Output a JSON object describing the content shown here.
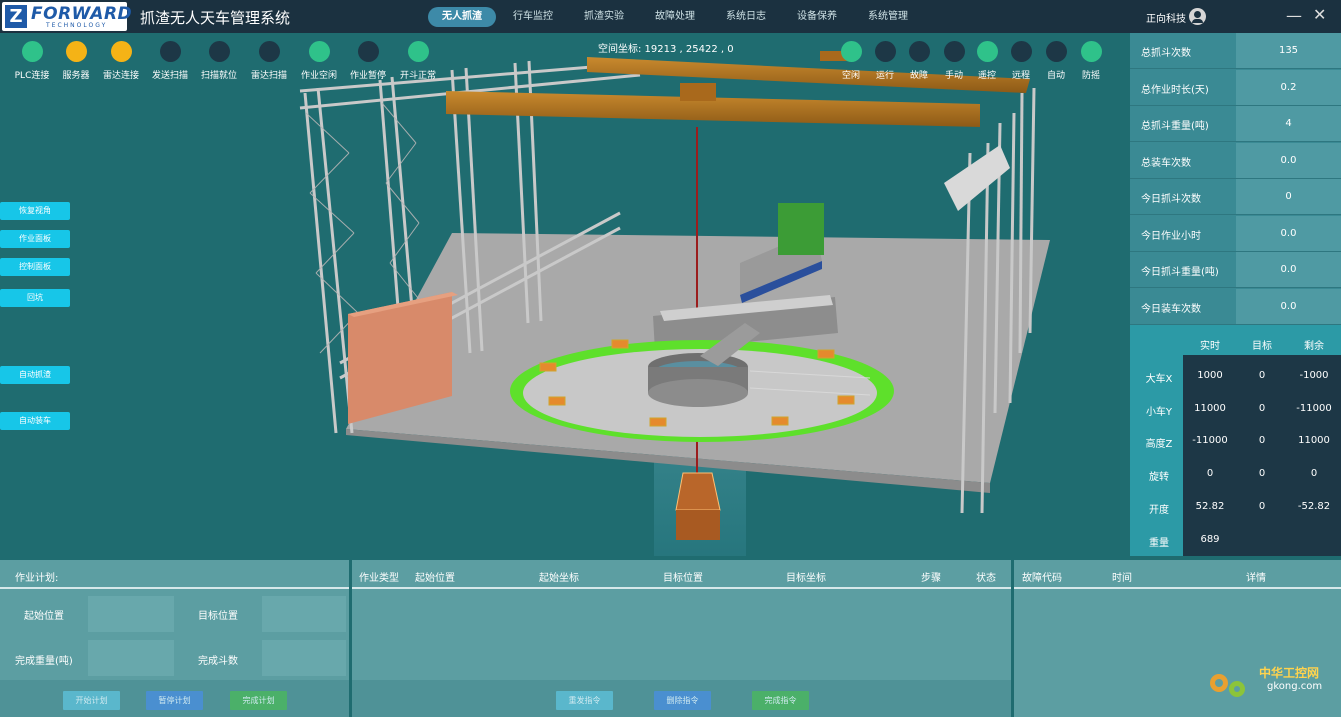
{
  "header": {
    "logo_brand": "FORWARD",
    "logo_sub": "TECHNOLOGY",
    "app_title": "抓渣无人天车管理系统",
    "tabs": [
      "无人抓渣",
      "行车监控",
      "抓渣实验",
      "故障处理",
      "系统日志",
      "设备保养",
      "系统管理"
    ],
    "active_tab": "无人抓渣",
    "company": "正向科技",
    "minimize": "—",
    "close": "✕"
  },
  "status_lights": [
    {
      "label": "PLC连接",
      "color": "#2fc28a"
    },
    {
      "label": "服务器",
      "color": "#f5b316"
    },
    {
      "label": "雷达连接",
      "color": "#f5b316"
    },
    {
      "label": "发送扫描",
      "color": "#1d3746"
    },
    {
      "label": "扫描就位",
      "color": "#1d3746"
    },
    {
      "label": "雷达扫描",
      "color": "#1d3746"
    },
    {
      "label": "作业空闲",
      "color": "#2fc28a"
    },
    {
      "label": "作业暂停",
      "color": "#1d3746"
    },
    {
      "label": "开斗正常",
      "color": "#2fc28a"
    }
  ],
  "mode_lights": [
    {
      "label": "空闲",
      "color": "#2fc28a"
    },
    {
      "label": "运行",
      "color": "#1d3746"
    },
    {
      "label": "故障",
      "color": "#1d3746"
    },
    {
      "label": "手动",
      "color": "#1d3746"
    },
    {
      "label": "遥控",
      "color": "#2fc28a"
    },
    {
      "label": "远程",
      "color": "#1d3746"
    },
    {
      "label": "自动",
      "color": "#1d3746"
    },
    {
      "label": "防摇",
      "color": "#2fc28a"
    }
  ],
  "space_coord": "空间坐标:  19213 , 25422 , 0",
  "side_buttons": [
    "恢复视角",
    "作业面板",
    "控制面板",
    "回坑",
    "自动抓渣",
    "自动装车"
  ],
  "stats": [
    {
      "label": "总抓斗次数",
      "value": "135"
    },
    {
      "label": "总作业时长(天)",
      "value": "0.2"
    },
    {
      "label": "总抓斗重量(吨)",
      "value": "4"
    },
    {
      "label": "总装车次数",
      "value": "0.0"
    },
    {
      "label": "今日抓斗次数",
      "value": "0"
    },
    {
      "label": "今日作业小时",
      "value": "0.0"
    },
    {
      "label": "今日抓斗重量(吨)",
      "value": "0.0"
    },
    {
      "label": "今日装车次数",
      "value": "0.0"
    }
  ],
  "axes": {
    "headers": [
      "实时",
      "目标",
      "剩余"
    ],
    "rows": [
      {
        "label": "大车X",
        "realtime": "1000",
        "target": "0",
        "remain": "-1000"
      },
      {
        "label": "小车Y",
        "realtime": "11000",
        "target": "0",
        "remain": "-11000"
      },
      {
        "label": "高度Z",
        "realtime": "-11000",
        "target": "0",
        "remain": "11000"
      },
      {
        "label": "旋转",
        "realtime": "0",
        "target": "0",
        "remain": "0"
      },
      {
        "label": "开度",
        "realtime": "52.82",
        "target": "0",
        "remain": "-52.82"
      },
      {
        "label": "重量",
        "realtime": "689",
        "target": "",
        "remain": ""
      }
    ]
  },
  "plan": {
    "title": "作业计划:",
    "start_pos": "起始位置",
    "target_pos": "目标位置",
    "done_weight": "完成重量(吨)",
    "done_buckets": "完成斗数",
    "btn_start": "开始计划",
    "btn_pause": "暂停计划",
    "btn_finish": "完成计划"
  },
  "cmd_table": {
    "headers": [
      "作业类型",
      "起始位置",
      "起始坐标",
      "目标位置",
      "目标坐标",
      "步骤",
      "状态"
    ],
    "btn_resend": "重发指令",
    "btn_delete": "删除指令",
    "btn_done": "完成指令"
  },
  "fault_table": {
    "headers": [
      "故障代码",
      "时间",
      "详情"
    ]
  },
  "watermark": {
    "text": "中华工控网",
    "url": "gkong.com"
  }
}
